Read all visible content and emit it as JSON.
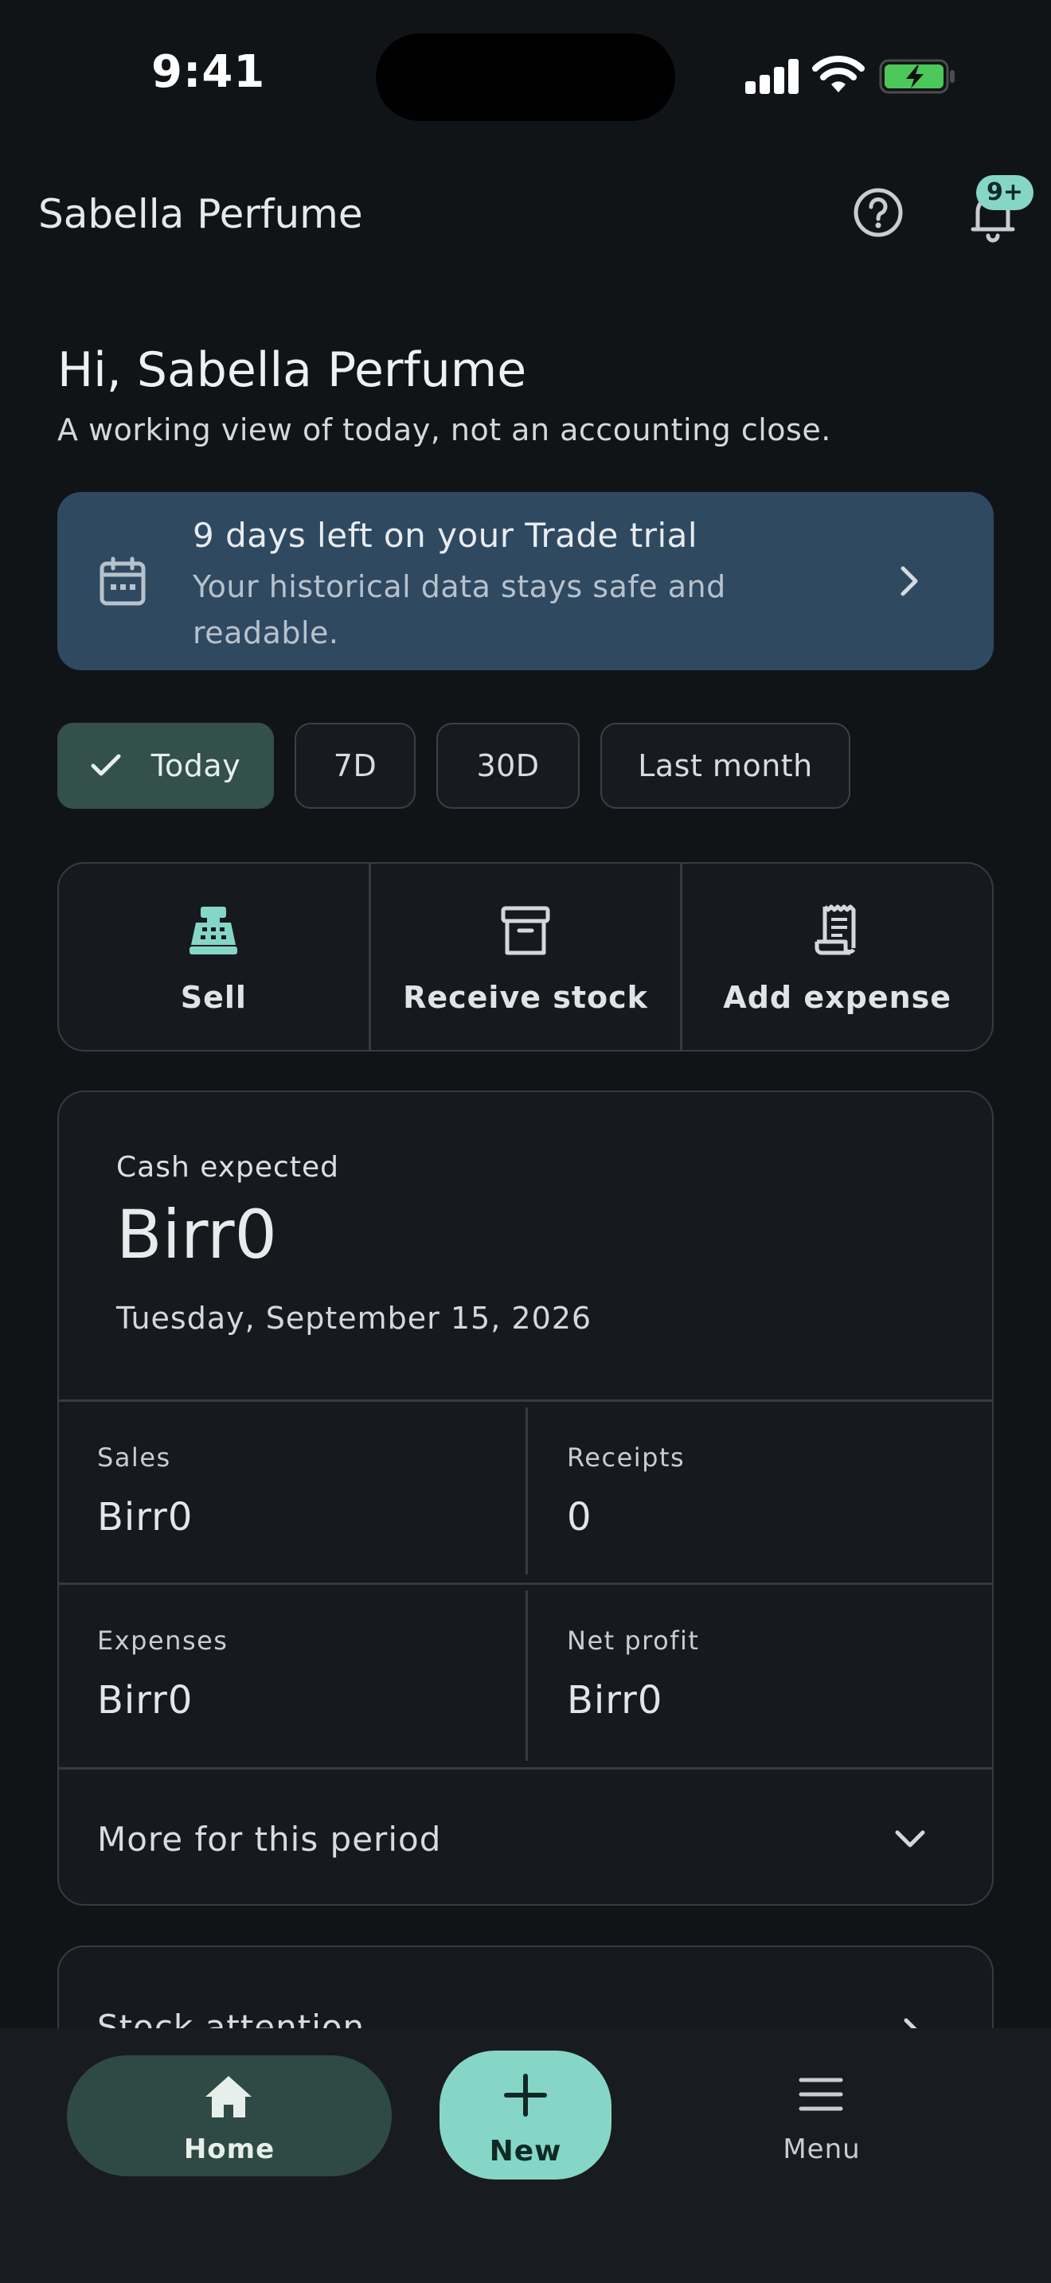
{
  "status_bar": {
    "time": "9:41"
  },
  "header": {
    "app_title": "Sabella Perfume",
    "notification_badge": "9+"
  },
  "greeting": {
    "title": "Hi, Sabella Perfume",
    "subtitle": "A working view of today, not an accounting close."
  },
  "trial_banner": {
    "title": "9 days left on your Trade trial",
    "body": "Your historical data stays safe and readable."
  },
  "period_chips": [
    {
      "label": "Today",
      "selected": true
    },
    {
      "label": "7D",
      "selected": false
    },
    {
      "label": "30D",
      "selected": false
    },
    {
      "label": "Last month",
      "selected": false
    }
  ],
  "quick_actions": [
    {
      "label": "Sell",
      "icon": "cash-register-icon"
    },
    {
      "label": "Receive stock",
      "icon": "archive-box-icon"
    },
    {
      "label": "Add expense",
      "icon": "receipt-icon"
    }
  ],
  "summary": {
    "cash_expected_label": "Cash expected",
    "cash_expected_value": "Birr0",
    "date": "Tuesday, September 15, 2026",
    "metrics": [
      {
        "label": "Sales",
        "value": "Birr0"
      },
      {
        "label": "Receipts",
        "value": "0"
      },
      {
        "label": "Expenses",
        "value": "Birr0"
      },
      {
        "label": "Net profit",
        "value": "Birr0"
      }
    ],
    "more_label": "More for this period"
  },
  "stock_attention": {
    "label": "Stock attention"
  },
  "bottom_nav": {
    "home": "Home",
    "new": "New",
    "menu": "Menu"
  },
  "colors": {
    "background": "#111417",
    "accent": "#86d6c7",
    "banner": "#2f4961",
    "chip_active": "#33504a"
  }
}
